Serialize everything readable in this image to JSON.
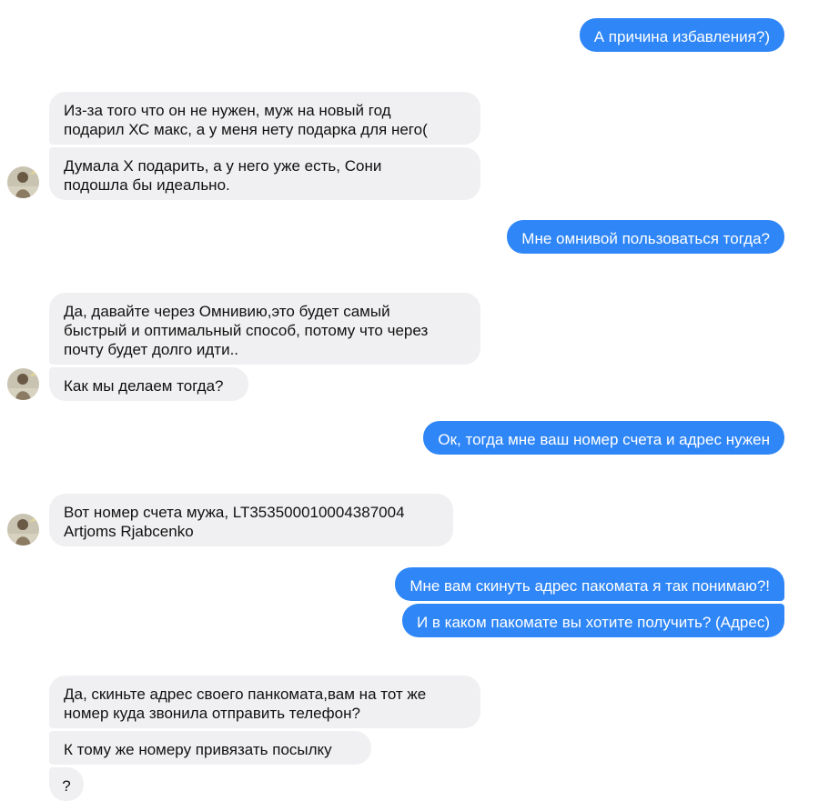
{
  "messages": [
    {
      "side": "out",
      "text": "А причина избавления?)"
    },
    {
      "side": "in",
      "text": "Из-за того что он не нужен, муж на новый год\nподарил ХС макс, а у меня нету подарка для него("
    },
    {
      "side": "in",
      "text": "Думала Х подарить, а у него уже есть, Сони\nподошла бы идеально."
    },
    {
      "side": "out",
      "text": "Мне омнивой пользоваться тогда?"
    },
    {
      "side": "in",
      "text": "Да, давайте через Омнивию,это будет самый\nбыстрый и оптимальный способ, потому что через\nпочту будет долго идти.."
    },
    {
      "side": "in",
      "text": "Как мы делаем тогда?"
    },
    {
      "side": "out",
      "text": "Ок, тогда мне ваш номер счета и адрес нужен"
    },
    {
      "side": "in",
      "text": "Вот номер счета мужа, LT353500010004387004\nArtjoms Rjabcenko"
    },
    {
      "side": "out",
      "text": "Мне вам скинуть адрес пакомата я так понимаю?!"
    },
    {
      "side": "out",
      "text": "И в каком пакомате вы хотите получить? (Адрес)"
    },
    {
      "side": "in",
      "text": "Да, скиньте адрес своего панкомата,вам на тот же\nномер куда звонила отправить телефон?"
    },
    {
      "side": "in",
      "text": "К тому же номеру привязать посылку"
    },
    {
      "side": "in",
      "text": "?"
    }
  ],
  "avatar_icon": "contact-avatar-photo",
  "colors": {
    "outgoing": "#2f86f6",
    "incoming": "#f0f0f2"
  }
}
